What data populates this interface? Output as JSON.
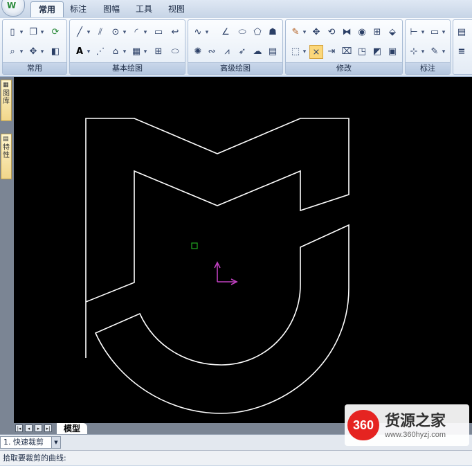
{
  "menu": {
    "tabs": [
      {
        "label": "常用",
        "active": true
      },
      {
        "label": "标注"
      },
      {
        "label": "图幅"
      },
      {
        "label": "工具"
      },
      {
        "label": "视图"
      }
    ]
  },
  "ribbon": {
    "groups": [
      {
        "label": "常用"
      },
      {
        "label": "基本绘图"
      },
      {
        "label": "高级绘图"
      },
      {
        "label": "修改"
      },
      {
        "label": "标注"
      }
    ]
  },
  "side_palette": {
    "tabs": [
      {
        "label": "图库"
      },
      {
        "label": "特性"
      }
    ]
  },
  "layout_tabs": {
    "model_label": "模型"
  },
  "command": {
    "combo_value": "1. 快速裁剪"
  },
  "status": {
    "prompt": "拾取要裁剪的曲线:"
  },
  "watermark": {
    "badge": "360",
    "title": "货源之家",
    "url": "www.360hyzj.com"
  },
  "colors": {
    "canvas": "#000000",
    "curve": "#ffffff",
    "ucs": "#c040c0",
    "pick_box": "#22aa22"
  }
}
